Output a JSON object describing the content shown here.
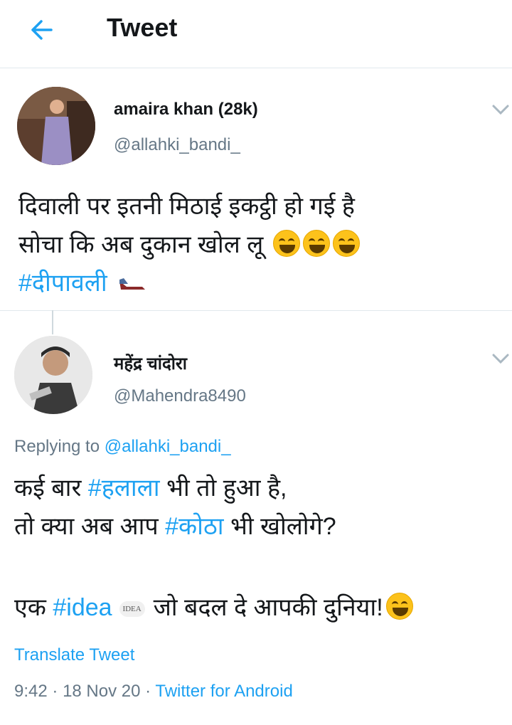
{
  "header": {
    "title": "Tweet",
    "back_icon": "back-arrow-icon"
  },
  "tweet": {
    "author_name": "amaira khan (28k)",
    "author_handle": "@allahki_bandi_",
    "line1": "दिवाली पर इतनी मिठाई इकट्ठी हो गई है",
    "line2": "सोचा कि अब दुकान खोल लू",
    "hashtag": "#दीपावली"
  },
  "reply": {
    "author_name": "महेंद्र चांदोरा",
    "author_handle": "@Mahendra8490",
    "replying_label": "Replying to",
    "replying_handle": "@allahki_bandi_",
    "l1_pre": "कई बार ",
    "l1_tag": "#हलाला",
    "l1_post": " भी तो हुआ है,",
    "l2_pre": "तो क्या अब आप ",
    "l2_tag": "#कोठा",
    "l2_post": " भी खोलोगे?",
    "l3_pre": "एक ",
    "l3_tag": "#idea",
    "idea_badge": "IDEA",
    "l3_post": "जो बदल दे आपकी दुनिया!",
    "translate": "Translate Tweet",
    "time": "9:42",
    "date": "18 Nov 20",
    "source": "Twitter for Android",
    "sep": "·"
  },
  "colors": {
    "accent": "#1da1f2",
    "secondary_text": "#657786",
    "divider": "#e1e8ed"
  }
}
